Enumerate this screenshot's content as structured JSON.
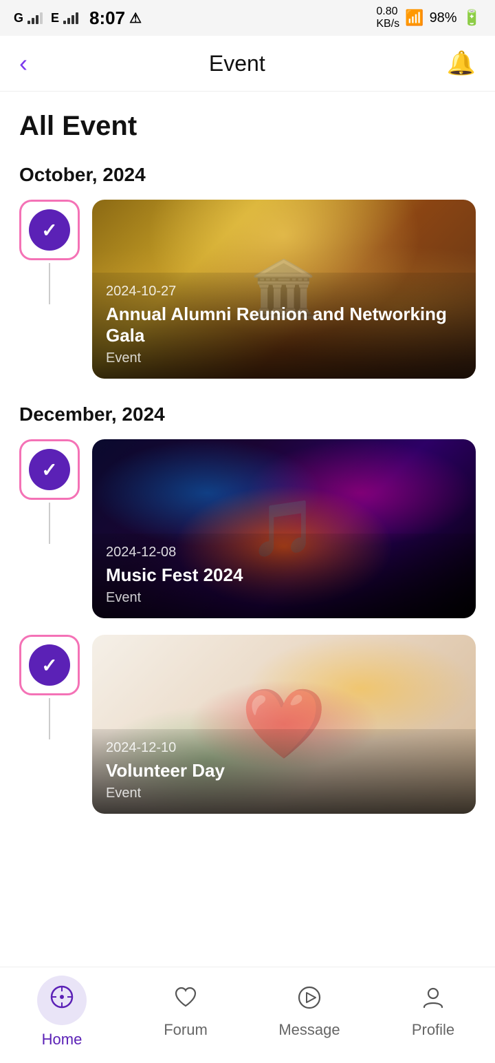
{
  "statusBar": {
    "time": "8:07",
    "carrier1": "G",
    "carrier2": "E",
    "battery": "98%",
    "wifi": "wifi"
  },
  "header": {
    "backLabel": "‹",
    "title": "Event",
    "notification": "🔔"
  },
  "pageTitle": "All Event",
  "sections": [
    {
      "month": "October, 2024",
      "events": [
        {
          "date": "2024-10-27",
          "name": "Annual Alumni Reunion and Networking Gala",
          "type": "Event",
          "imgClass": "img-gala"
        }
      ]
    },
    {
      "month": "December, 2024",
      "events": [
        {
          "date": "2024-12-08",
          "name": "Music Fest 2024",
          "type": "Event",
          "imgClass": "img-music"
        },
        {
          "date": "2024-12-10",
          "name": "Volunteer Day",
          "type": "Event",
          "imgClass": "img-volunteer"
        }
      ]
    }
  ],
  "bottomNav": {
    "items": [
      {
        "id": "home",
        "label": "Home",
        "icon": "compass",
        "active": true
      },
      {
        "id": "forum",
        "label": "Forum",
        "icon": "heart",
        "active": false
      },
      {
        "id": "message",
        "label": "Message",
        "icon": "play",
        "active": false
      },
      {
        "id": "profile",
        "label": "Profile",
        "icon": "person",
        "active": false
      }
    ]
  }
}
